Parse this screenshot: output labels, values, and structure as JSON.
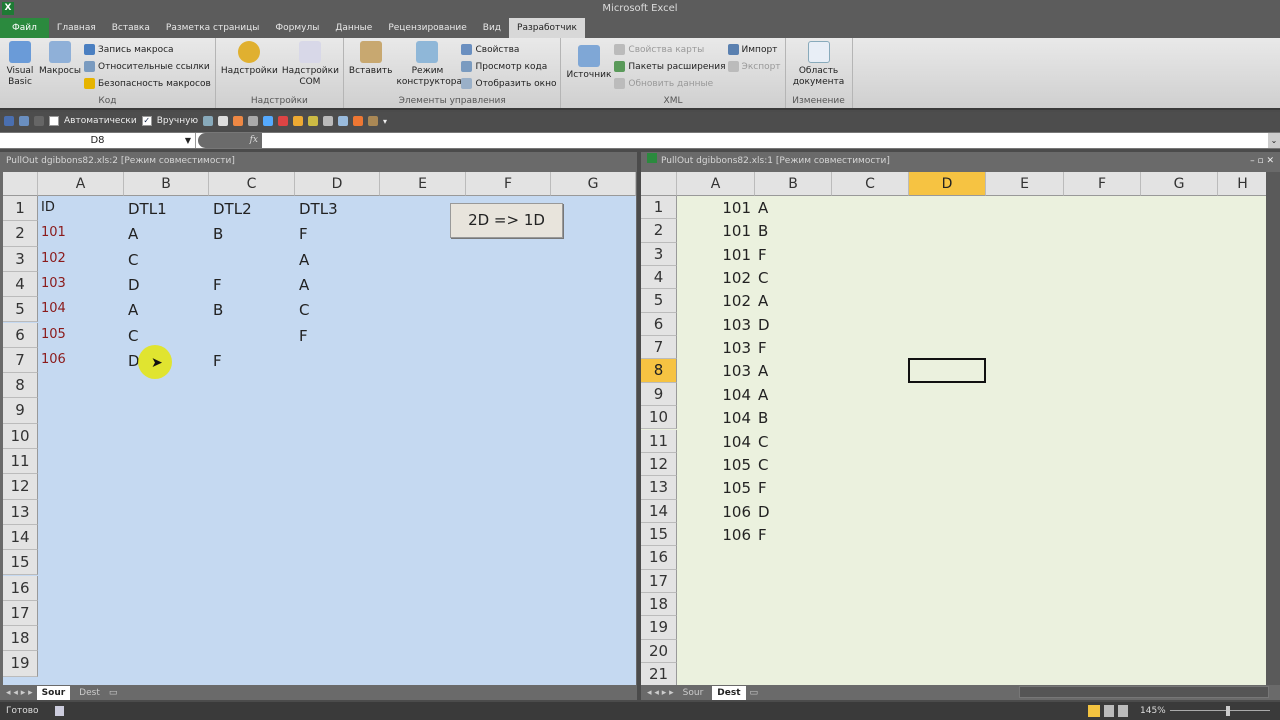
{
  "app": {
    "title": "Microsoft Excel",
    "icon_letter": "X"
  },
  "tabs": [
    "Файл",
    "Главная",
    "Вставка",
    "Разметка страницы",
    "Формулы",
    "Данные",
    "Рецензирование",
    "Вид",
    "Разработчик"
  ],
  "ribbon": {
    "code": {
      "label": "Код",
      "visual_basic": "Visual Basic",
      "macros": "Макросы",
      "record": "Запись макроса",
      "relative": "Относительные ссылки",
      "security": "Безопасность макросов"
    },
    "addins": {
      "label": "Надстройки",
      "addins": "Надстройки",
      "com": "Надстройки COM"
    },
    "controls": {
      "label": "Элементы управления",
      "insert": "Вставить",
      "design": "Режим конструктора",
      "properties": "Свойства",
      "view_code": "Просмотр кода",
      "dialog": "Отобразить окно"
    },
    "xml": {
      "label": "XML",
      "source": "Источник",
      "map_props": "Свойства карты",
      "packs": "Пакеты расширения",
      "refresh": "Обновить данные",
      "import": "Импорт",
      "export": "Экспорт"
    },
    "modify": {
      "label": "Изменение",
      "doc_panel": "Область документа"
    }
  },
  "qat": {
    "auto": "Автоматически",
    "manual": "Вручную"
  },
  "formula": {
    "name_box": "D8",
    "fx": "fx",
    "value": ""
  },
  "left_window": {
    "title": "PullOut dgibbons82.xls:2  [Режим совместимости]",
    "columns": [
      "A",
      "B",
      "C",
      "D",
      "E",
      "F",
      "G"
    ],
    "rows": 19,
    "cells": [
      [
        "ID",
        "DTL1",
        "DTL2",
        "DTL3"
      ],
      [
        "101",
        "A",
        "B",
        "F"
      ],
      [
        "102",
        "C",
        "",
        "A"
      ],
      [
        "103",
        "D",
        "F",
        "A"
      ],
      [
        "104",
        "A",
        "B",
        "C"
      ],
      [
        "105",
        "C",
        "",
        "F"
      ],
      [
        "106",
        "D",
        "F",
        ""
      ]
    ],
    "button": "2D => 1D",
    "sheets": [
      "Sour",
      "Dest"
    ],
    "active_sheet": "Sour"
  },
  "right_window": {
    "title": "PullOut dgibbons82.xls:1  [Режим совместимости]",
    "columns": [
      "A",
      "B",
      "C",
      "D",
      "E",
      "F",
      "G",
      "H"
    ],
    "rows": 21,
    "active_cell": "D8",
    "cells": [
      [
        "101",
        "A"
      ],
      [
        "101",
        "B"
      ],
      [
        "101",
        "F"
      ],
      [
        "102",
        "C"
      ],
      [
        "102",
        "A"
      ],
      [
        "103",
        "D"
      ],
      [
        "103",
        "F"
      ],
      [
        "103",
        "A"
      ],
      [
        "104",
        "A"
      ],
      [
        "104",
        "B"
      ],
      [
        "104",
        "C"
      ],
      [
        "105",
        "C"
      ],
      [
        "105",
        "F"
      ],
      [
        "106",
        "D"
      ],
      [
        "106",
        "F"
      ]
    ],
    "sheets": [
      "Sour",
      "Dest"
    ],
    "active_sheet": "Dest"
  },
  "status": {
    "ready": "Готово",
    "zoom": "145%"
  }
}
